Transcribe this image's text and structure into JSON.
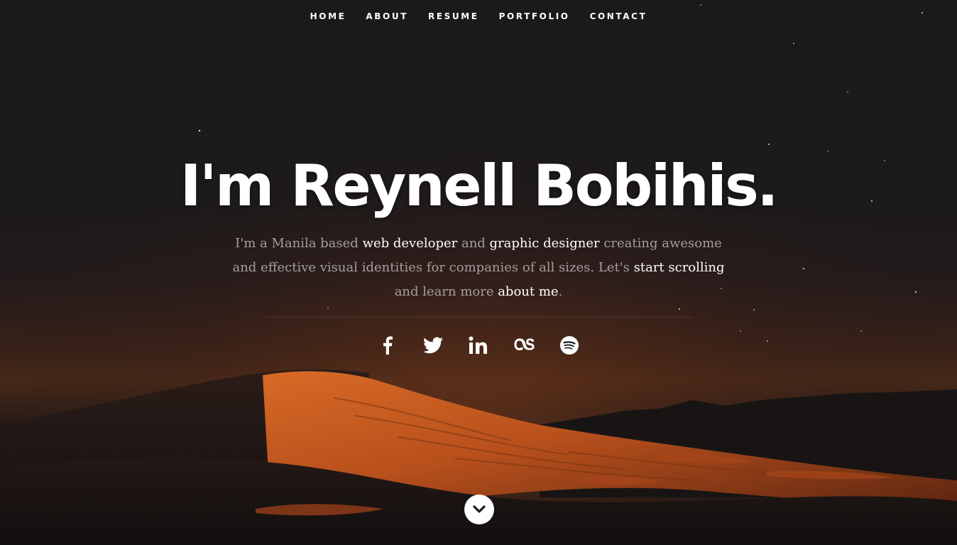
{
  "nav": {
    "items": [
      {
        "label": "HOME"
      },
      {
        "label": "ABOUT"
      },
      {
        "label": "RESUME"
      },
      {
        "label": "PORTFOLIO"
      },
      {
        "label": "CONTACT"
      }
    ]
  },
  "hero": {
    "headline": "I'm Reynell Bobihis.",
    "intro": {
      "part1": "I'm a Manila based ",
      "link1": "web developer",
      "part2": " and ",
      "link2": "graphic designer",
      "part3": " creating awesome and effective visual identities for companies of all sizes. Let's ",
      "link3": "start scrolling",
      "part4": " and learn more ",
      "link4": "about me",
      "part5": "."
    }
  },
  "social": {
    "icons": [
      "facebook-icon",
      "twitter-icon",
      "linkedin-icon",
      "lastfm-icon",
      "spotify-icon"
    ]
  },
  "scroll": {
    "icon": "chevron-down-icon"
  },
  "colors": {
    "text": "#ffffff",
    "muted": "#a49e9d",
    "background": "#1a1819",
    "accent_dune": "#c4571e"
  }
}
